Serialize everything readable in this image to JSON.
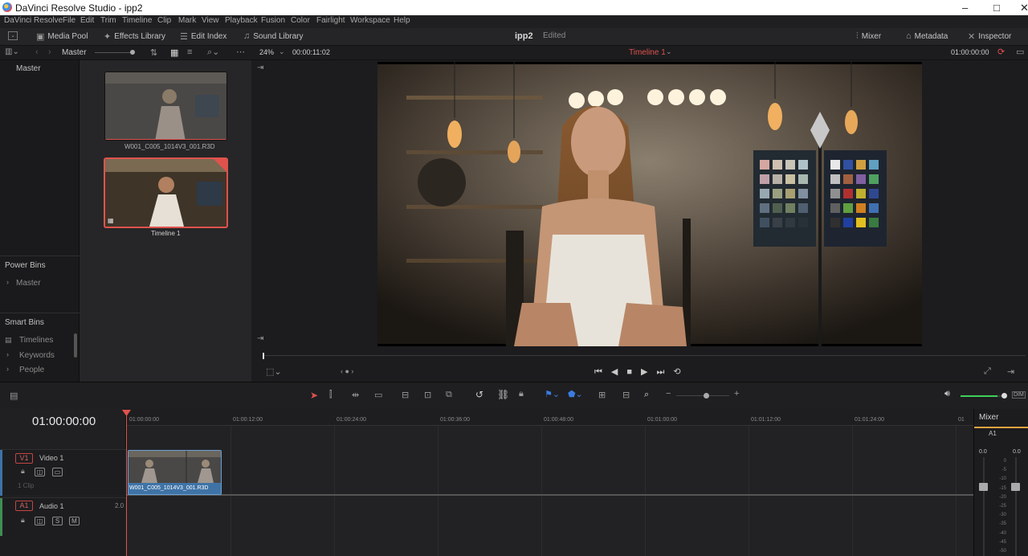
{
  "window": {
    "title": "DaVinci Resolve Studio - ipp2",
    "minimize": "–",
    "maximize": "□",
    "close": "✕"
  },
  "menu": [
    "DaVinci Resolve",
    "File",
    "Edit",
    "Trim",
    "Timeline",
    "Clip",
    "Mark",
    "View",
    "Playback",
    "Fusion",
    "Color",
    "Fairlight",
    "Workspace",
    "Help"
  ],
  "toolbar": {
    "media_pool": "Media Pool",
    "effects_library": "Effects Library",
    "edit_index": "Edit Index",
    "sound_library": "Sound Library",
    "project_name": "ipp2",
    "project_status": "Edited",
    "mixer": "Mixer",
    "metadata": "Metadata",
    "inspector": "Inspector"
  },
  "subbar": {
    "bin_path": "Master",
    "zoom": "24%",
    "source_timecode": "00:00:11:02",
    "timeline_name": "Timeline 1",
    "record_timecode": "01:00:00:00"
  },
  "bins": {
    "master": "Master",
    "power_bins_title": "Power Bins",
    "power_bins_master": "Master",
    "smart_bins_title": "Smart Bins",
    "smart_bins": [
      "Timelines",
      "Keywords",
      "People"
    ]
  },
  "media_pool": {
    "clips": [
      {
        "name": "W001_C005_1014V3_001.R3D",
        "selected": false
      },
      {
        "name": "Timeline 1",
        "selected": true
      }
    ]
  },
  "timeline": {
    "timecode": "01:00:00:00",
    "ruler": [
      "01:00:00:00",
      "01:00:12:00",
      "01:00:24:00",
      "01:00:36:00",
      "01:00:48:00",
      "01:01:00:00",
      "01:01:12:00",
      "01:01:24:00",
      "01"
    ],
    "video_track": {
      "id": "V1",
      "name": "Video 1",
      "clip_count": "1 Clip",
      "clip_name": "W001_C005_1014V3_001.R3D"
    },
    "audio_track": {
      "id": "A1",
      "name": "Audio 1",
      "channels": "2.0",
      "solo": "S",
      "mute": "M"
    },
    "volume_fill": 0.85
  },
  "mixer": {
    "title": "Mixer",
    "channel": "A1",
    "gain": "0.0",
    "scale": [
      "0",
      "-5",
      "-10",
      "-15",
      "-20",
      "-25",
      "-30",
      "-35",
      "-40",
      "-45",
      "-50"
    ]
  },
  "colors": {
    "accent_red": "#e0524d",
    "clip_blue": "#3f73a6",
    "track_red": "#c34545"
  }
}
